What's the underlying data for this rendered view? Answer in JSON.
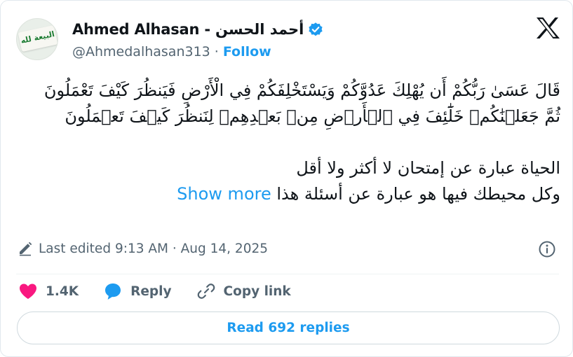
{
  "author": {
    "display_name": "Ahmed Alhasan - أحمد الحسن",
    "handle": "@Ahmedalhasan313",
    "separator": "·",
    "follow_label": "Follow",
    "avatar_text": "البيعة لله"
  },
  "tweet": {
    "lines": [
      "قَالَ عَسَىٰ رَبُّكُمْ أَن يُهْلِكَ عَدُوَّكُمْ وَيَسْتَخْلِفَكُمْ فِي الْأَرْضِ فَيَنظُرَ كَيْفَ تَعْمَلُونَ",
      "ثُمَّ جَعَلۡنَٰكُمۡ خَلَٰٓئِفَ فِي ٱلۡأَرۡضِ مِنۢ بَعۡدِهِمۡ لِنَنظُرَ كَيۡفَ تَعۡمَلُونَ"
    ],
    "lines2": [
      "الحياة عبارة عن إمتحان لا أكثر ولا أقل",
      "وكل محيطك فيها هو عبارة عن أسئلة هذا"
    ],
    "show_more_label": "Show more"
  },
  "meta": {
    "edited_text": "Last edited 9:13 AM · Aug 14, 2025"
  },
  "actions": {
    "likes_count": "1.4K",
    "reply_label": "Reply",
    "copy_link_label": "Copy link"
  },
  "footer": {
    "read_replies_label": "Read 692 replies"
  },
  "colors": {
    "accent": "#1d9bf0",
    "like": "#f91880",
    "muted": "#536471",
    "text": "#0f1419"
  },
  "icons": {
    "verified": "verified-badge-icon",
    "brand": "x-logo-icon",
    "edit": "pencil-icon",
    "info": "info-icon",
    "like": "heart-icon",
    "reply": "reply-bubble-icon",
    "copy_link": "link-icon"
  }
}
